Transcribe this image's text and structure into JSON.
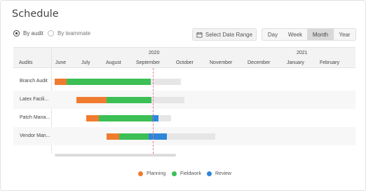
{
  "title": "Schedule",
  "view_toggle": {
    "by_audit": "By audit",
    "by_teammate": "By teammate"
  },
  "date_range_label": "Select Date Range",
  "zoom_options": [
    "Day",
    "Week",
    "Month",
    "Year"
  ],
  "zoom_selected": "Month",
  "table": {
    "audits_header": "Audits",
    "years": [
      "2020",
      "2021"
    ],
    "months": [
      "June",
      "July",
      "August",
      "September",
      "October",
      "November",
      "December",
      "January",
      "February"
    ],
    "rows": [
      {
        "label": "Branch Audit"
      },
      {
        "label": "Latex Facili..."
      },
      {
        "label": "Patch Mana..."
      },
      {
        "label": "Vendor Man..."
      }
    ]
  },
  "legend": [
    {
      "label": "Planning",
      "color": "#f07b2e"
    },
    {
      "label": "Fieldwork",
      "color": "#3cbf55"
    },
    {
      "label": "Review",
      "color": "#2e86d9"
    }
  ],
  "colors": {
    "planning": "#f07b2e",
    "fieldwork": "#3cbf55",
    "review": "#2e86d9",
    "remaining": "#e6e6e6",
    "today_marker": "#e57b9a"
  }
}
